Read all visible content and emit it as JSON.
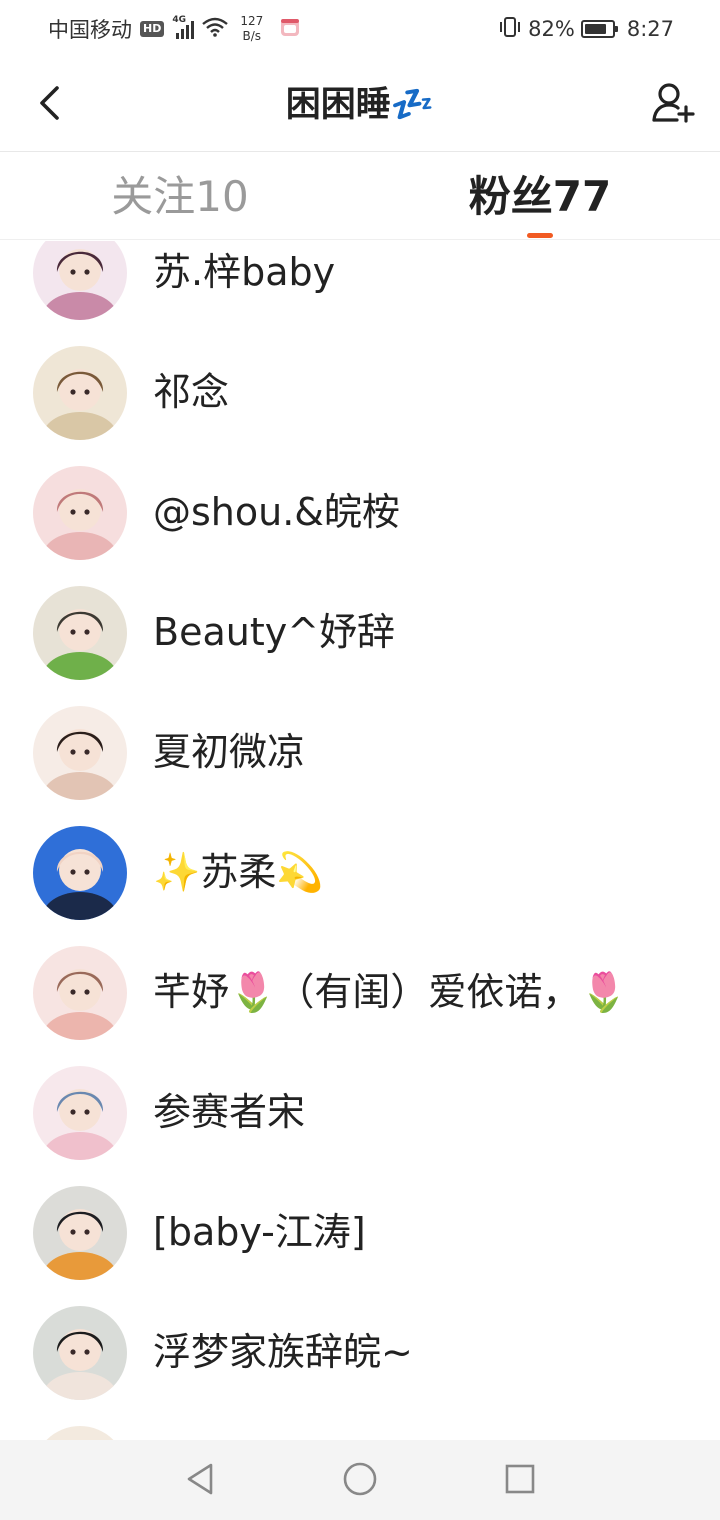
{
  "status_bar": {
    "carrier": "中国移动",
    "hd_label": "HD",
    "signal_label": "4G",
    "net_speed_value": "127",
    "net_speed_unit": "B/s",
    "battery_percent": "82%",
    "battery_level": 0.82,
    "time": "8:27"
  },
  "header": {
    "title": "困困睡💤",
    "back_icon": "chevron-left-icon",
    "add_icon": "add-user-icon"
  },
  "tabs": [
    {
      "label": "关注10",
      "active": false
    },
    {
      "label": "粉丝77",
      "active": true
    }
  ],
  "accent_color": "#f15a22",
  "fans": [
    {
      "name": "苏.梓baby",
      "avatar_colors": [
        "#f3e6ee",
        "#c98aa8",
        "#4a2a3a"
      ]
    },
    {
      "name": "祁念",
      "avatar_colors": [
        "#efe6d6",
        "#d9c7a6",
        "#7a5a3a"
      ]
    },
    {
      "name": "@shou.&皖桉",
      "avatar_colors": [
        "#f6dede",
        "#e9b5b5",
        "#c07a7a"
      ]
    },
    {
      "name": "Beauty^妤辞",
      "avatar_colors": [
        "#e7e2d6",
        "#6fb04a",
        "#3d3a33"
      ]
    },
    {
      "name": "夏初微凉",
      "avatar_colors": [
        "#f6ece6",
        "#e2c4b4",
        "#2b1e1a"
      ]
    },
    {
      "name": "✨苏柔💫",
      "avatar_colors": [
        "#2f6fd8",
        "#1b2a4a",
        "#f1d3c4"
      ]
    },
    {
      "name": "芊妤🌷（有闺）爱依诺，🌷",
      "avatar_colors": [
        "#f7e4e2",
        "#ecb5ad",
        "#9a6a5a"
      ]
    },
    {
      "name": "参赛者宋",
      "avatar_colors": [
        "#f7e8ec",
        "#f0c0cc",
        "#6a88b0"
      ]
    },
    {
      "name": "[baby-江涛]",
      "avatar_colors": [
        "#dcdcd8",
        "#e89a3a",
        "#1e1e22"
      ]
    },
    {
      "name": "浮梦家族辞皖~",
      "avatar_colors": [
        "#d9dcd8",
        "#f0e4dc",
        "#1c1c1c"
      ]
    },
    {
      "name": "",
      "avatar_colors": [
        "#f3eadf",
        "#e8d6c0",
        "#c9b090"
      ]
    }
  ],
  "nav": {
    "back_icon": "triangle-back-icon",
    "home_icon": "circle-home-icon",
    "recents_icon": "square-recents-icon"
  }
}
